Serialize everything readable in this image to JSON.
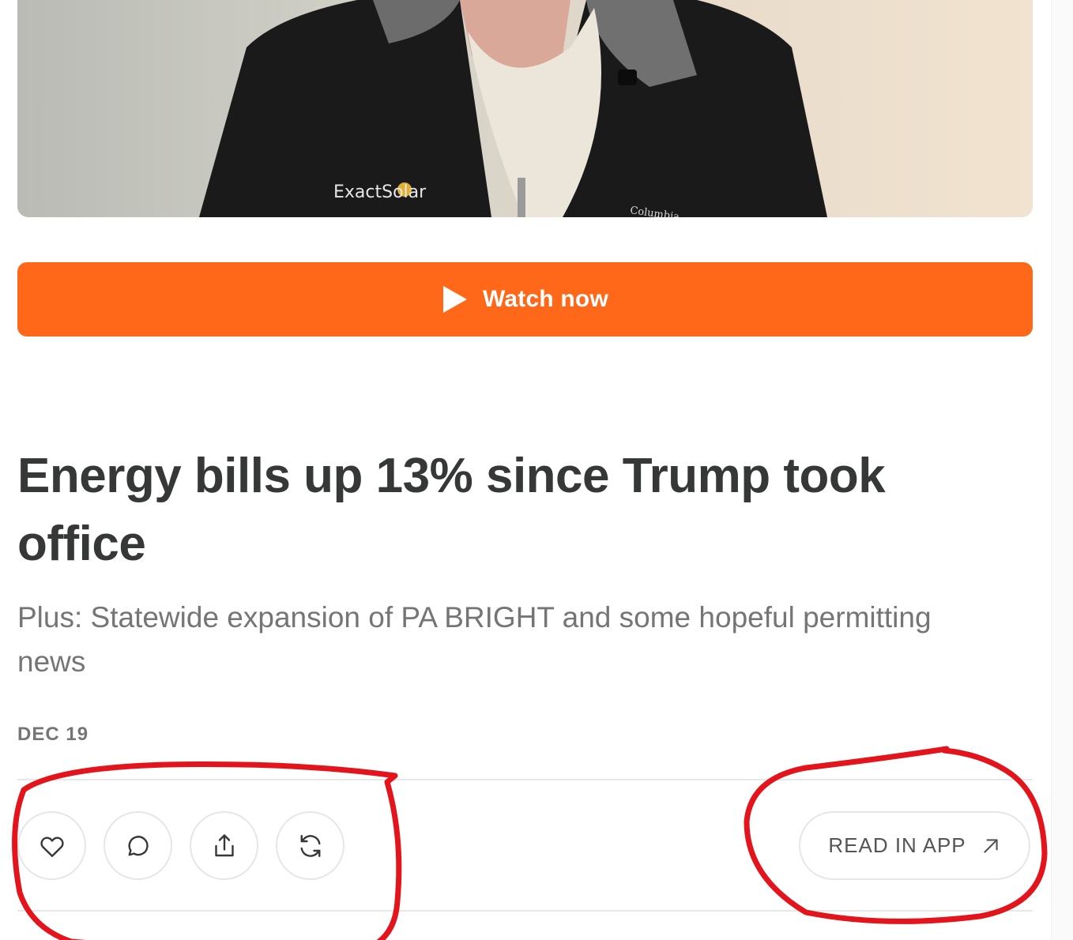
{
  "video": {
    "jacket_logo_text": "ExactSolar",
    "jacket_brand_text": "Columbia"
  },
  "watch_button": {
    "label": "Watch now"
  },
  "post": {
    "title": "Energy bills up 13% since Trump took office",
    "subtitle": "Plus: Statewide expansion of PA BRIGHT and some hopeful permitting news",
    "date": "DEC 19"
  },
  "actions": {
    "icons": [
      "heart-icon",
      "comment-icon",
      "share-icon",
      "restack-icon"
    ],
    "read_in_app_label": "READ IN APP"
  },
  "colors": {
    "accent": "#ff6719",
    "title_text": "#363737",
    "muted_text": "#757575",
    "annotation": "#e3141b"
  }
}
